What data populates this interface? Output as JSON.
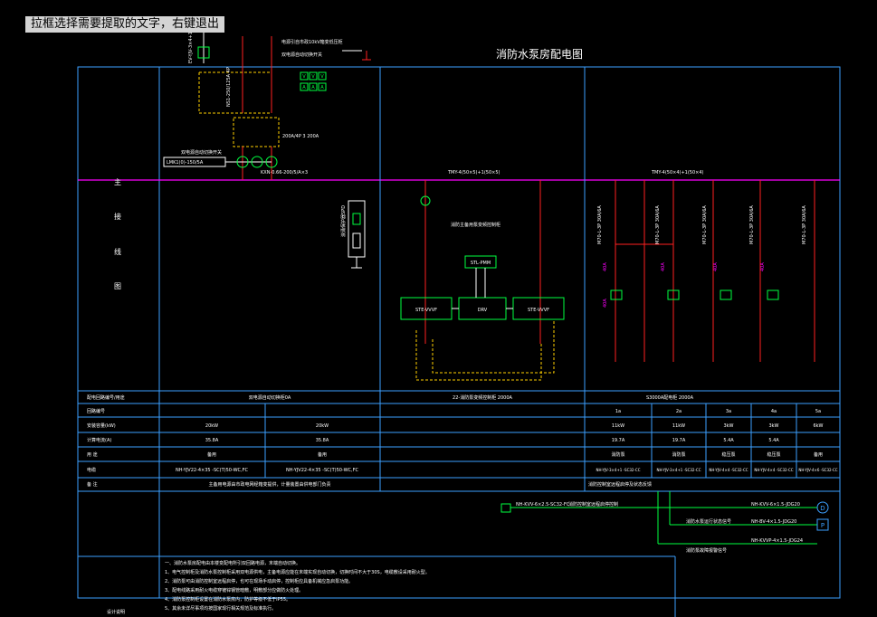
{
  "hint": "拉框选择需要提取的文字，右键退出",
  "title": "消防水泵房配电图",
  "left_label_chars": [
    "主",
    "接",
    "线",
    "图"
  ],
  "busbars": {
    "a": "KXN-0.66-200/5/A×3",
    "b": "TMY-4(50×5)+1(50×5)",
    "c": "TMY-4(50×4)+1(50×4)"
  },
  "incoming": {
    "cable": "EV-YJV-3×4+1×2.5",
    "breaker_label": "NS1-250/125A 4P",
    "ct_label": "LMK1(0)-150/5A",
    "note_a": "电源引自市政10kV箱变低压柜",
    "note_b": "双电源自动切换开关",
    "atse": "200A/4P 3 200A",
    "tags": [
      "V",
      "V",
      "V",
      "A",
      "A",
      "A"
    ]
  },
  "spd_label": "浪涌保护器SPD",
  "vfd_note": "消防主备用泵变频控制柜",
  "vfd_boxes": {
    "top": "STL-PMM",
    "left": "STE-VVVF",
    "mid": "DRV",
    "right": "STE-VVVF"
  },
  "feeder_labels": [
    "M70-L-3P 30A/6A",
    "M70-L-3P 30A/6A",
    "M70-L-3P 30A/6A",
    "M70-L-3P 30A/6A",
    "M70-L-3P 30A/6A"
  ],
  "feeder_ratings": [
    "40A",
    "40A",
    "40A",
    "40A",
    "40A"
  ],
  "table": {
    "row_labels": [
      "配电回路编号/用途",
      "回路编号",
      "安装容量(kW)",
      "计算电流(A)",
      "用  途",
      "电缆",
      "备  注"
    ],
    "groups": [
      "双电源自动切换柜0A",
      "22-消防泵变频控制柜 2000A",
      "S3000A配电柜 2000A"
    ],
    "cols": [
      {
        "num": "",
        "power": "20kW",
        "current": "35.8A",
        "use": "备用",
        "cable": "NH-YJV22-4×35 -SC(T)50-WC,FC"
      },
      {
        "num": "",
        "power": "20kW",
        "current": "35.8A",
        "use": "备用",
        "cable": "NH-YJV22-4×35 -SC(T)50-WC,FC"
      },
      {
        "num": "",
        "power": "",
        "current": "",
        "use": "",
        "cable": ""
      },
      {
        "num": "1a",
        "power": "11kW",
        "current": "19.7A",
        "use": "消防泵",
        "cable": "NH-YJV-3×4+1 -SC32-CC"
      },
      {
        "num": "2a",
        "power": "11kW",
        "current": "19.7A",
        "use": "消防泵",
        "cable": "NH-YJV-3×4+1 -SC32-CC"
      },
      {
        "num": "3a",
        "power": "3kW",
        "current": "5.4A",
        "use": "稳压泵",
        "cable": "NH-YJV-4×4 -SC32-CC"
      },
      {
        "num": "4a",
        "power": "3kW",
        "current": "5.4A",
        "use": "稳压泵",
        "cable": "NH-YJV-4×4 -SC32-CC"
      },
      {
        "num": "5a",
        "power": "6kW",
        "current": "",
        "use": "备用",
        "cable": "NH-YJV-4×6 -SC32-CC"
      }
    ],
    "remark_left": "主备用电源由市政电网经箱变提供，计量装置由供电部门负责",
    "remark_right": "消防控制室远程启停及状态反馈"
  },
  "signals": [
    {
      "text": "NH-KVV-6×2.5-SC32-FC",
      "note": "消防控制室远程启停控制",
      "cable": "NH-KVV-6×1.5-JDG20",
      "badge": "D"
    },
    {
      "text": "",
      "note": "消防水泵运行状态信号",
      "cable": "NH-BV-4×1.5-JDG20",
      "badge": "P"
    },
    {
      "text": "",
      "note": "消防泵故障报警信号",
      "cable": "NH-KVVP-4×1.5-JDG24",
      "badge": ""
    }
  ],
  "notes_label": "设计说明",
  "notes": [
    "一、消防水泵房配电由本楼变配电所引双回路电源，末端自动切换。",
    "1、电气控制柜及消防水泵控制柜采用双电源供电，主备电源应能在末端实现自动切换，切换时间不大于30S，电缆敷设采用耐火型。",
    "2、消防泵可由消防控制室远程启停，也可在现场手动启停，控制柜应具备机械应急启泵功能。",
    "3、配电线路采用耐火电缆穿镀锌钢管暗敷，明敷部分应做防火处理。",
    "4、消防泵控制柜设置在消防水泵房内，防护等级不低于IP55。",
    "5、其余未详尽事项均按国家现行相关规范及标准执行。"
  ],
  "colors": {
    "frame": "#3ca0ff",
    "bus": "#ff00ff",
    "red": "#ff2020",
    "yellow": "#ffd000",
    "green": "#00ff40",
    "white": "#ffffff",
    "magenta": "#ff00ff"
  }
}
